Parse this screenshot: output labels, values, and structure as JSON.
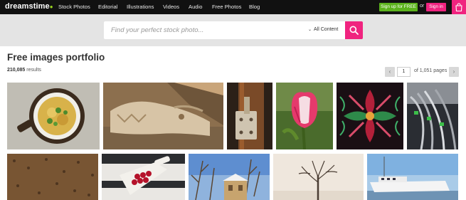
{
  "header": {
    "logo": "dreamstime",
    "nav": [
      {
        "label": "Stock Photos"
      },
      {
        "label": "Editorial"
      },
      {
        "label": "Illustrations"
      },
      {
        "label": "Videos"
      },
      {
        "label": "Audio"
      },
      {
        "label": "Free Photos"
      },
      {
        "label": "Blog"
      }
    ],
    "signup_label": "Sign up for FREE",
    "or_label": "or",
    "signin_label": "Sign in"
  },
  "search": {
    "placeholder": "Find your perfect stock photo...",
    "filter_label": "All Content",
    "filter_icon": "chevron-down-icon",
    "button_icon": "search-icon"
  },
  "page": {
    "title": "Free images portfolio",
    "results_count": "210,085",
    "results_label": "results"
  },
  "pagination": {
    "current_page": "1",
    "of_label": "of 1,051 pages",
    "prev_icon": "chevron-left-icon",
    "next_icon": "chevron-right-icon"
  },
  "colors": {
    "topbar": "#111111",
    "accent_pink": "#f0237f",
    "signup_green": "#5cb31d",
    "search_band": "#e4e4e4"
  },
  "images": [
    {
      "subject": "gratin-dish"
    },
    {
      "subject": "wooden-dragon-carving"
    },
    {
      "subject": "rusty-latch"
    },
    {
      "subject": "pink-tulip"
    },
    {
      "subject": "kaleidoscope-pattern"
    },
    {
      "subject": "network-cables"
    },
    {
      "subject": "soil-texture"
    },
    {
      "subject": "cherries-board"
    },
    {
      "subject": "winter-house"
    },
    {
      "subject": "bare-tree"
    },
    {
      "subject": "white-ship"
    }
  ]
}
